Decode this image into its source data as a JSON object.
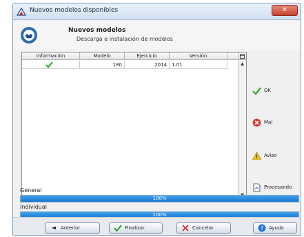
{
  "window": {
    "title": "Nuevos modelos disponibles",
    "close_label": "✕"
  },
  "header": {
    "title": "Nuevos modelos",
    "subtitle": "Descarga e instalación de modelos"
  },
  "table": {
    "columns": [
      "Información",
      "Modelo",
      "Ejercicio",
      "Versión"
    ],
    "rows": [
      {
        "info_icon": "check-icon",
        "modelo": "180",
        "ejercicio": "2014",
        "version": "1.01"
      }
    ]
  },
  "legend": {
    "ok": {
      "label": "OK",
      "icon": "check-icon"
    },
    "mal": {
      "label": "Mal",
      "icon": "error-icon"
    },
    "aviso": {
      "label": "Aviso",
      "icon": "warning-icon"
    },
    "procesando": {
      "label": "Procesando",
      "icon": "document-icon"
    }
  },
  "progress": {
    "general": {
      "label": "General",
      "value_text": "100%",
      "fraction": 1.0
    },
    "individual": {
      "label": "Individual",
      "value_text": "100%",
      "fraction": 1.0
    }
  },
  "buttons": {
    "anterior": "Anterior",
    "finalizar": "Finalizar",
    "cancelar": "Cancelar",
    "ayuda": "Ayuda"
  },
  "colors": {
    "ok_green": "#2aa02a",
    "error_red": "#d23a30",
    "warning_yellow": "#f0c419",
    "progress_blue": "#1f86dc"
  }
}
